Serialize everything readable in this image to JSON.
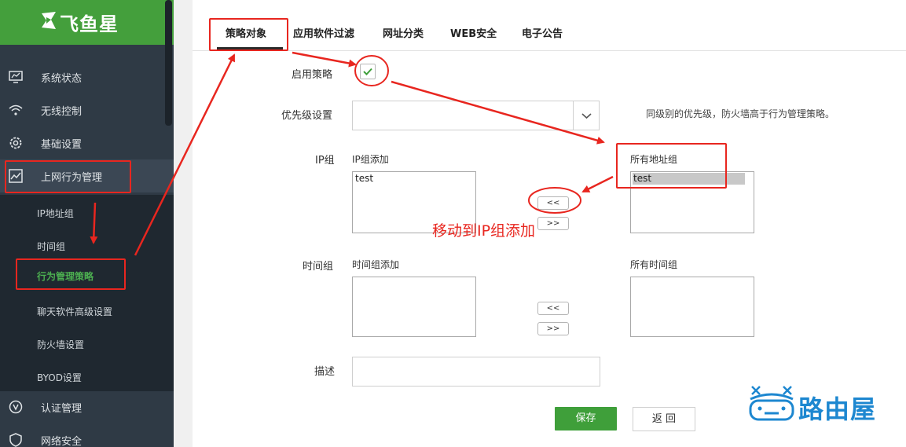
{
  "brand": {
    "name": "飞鱼星"
  },
  "sidebar": {
    "items": [
      {
        "label": "系统状态",
        "icon": "monitor-icon"
      },
      {
        "label": "无线控制",
        "icon": "wifi-icon"
      },
      {
        "label": "基础设置",
        "icon": "gear-icon"
      },
      {
        "label": "上网行为管理",
        "icon": "chart-icon"
      },
      {
        "label": "认证管理",
        "icon": "v-circle-icon"
      },
      {
        "label": "网络安全",
        "icon": "shield-icon"
      }
    ],
    "submenu": [
      {
        "label": "IP地址组"
      },
      {
        "label": "时间组"
      },
      {
        "label": "行为管理策略"
      },
      {
        "label": "聊天软件高级设置"
      },
      {
        "label": "防火墙设置"
      },
      {
        "label": "BYOD设置"
      }
    ]
  },
  "tabs": [
    "策略对象",
    "应用软件过滤",
    "网址分类",
    "WEB安全",
    "电子公告"
  ],
  "form": {
    "enable_label": "启用策略",
    "priority_label": "优先级设置",
    "priority_value": "",
    "priority_hint": "同级别的优先级，防火墙高于行为管理策略。",
    "ip_group_label": "IP组",
    "ip_add_label": "IP组添加",
    "ip_add_items": [
      "test"
    ],
    "all_address_label": "所有地址组",
    "all_address_items": [
      "test"
    ],
    "time_group_label": "时间组",
    "time_add_label": "时间组添加",
    "all_time_label": "所有时间组",
    "move_left": "<<",
    "move_right": ">>",
    "desc_label": "描述",
    "desc_value": "",
    "save": "保存",
    "back": "返 回"
  },
  "annotation": {
    "text": "移动到IP组添加"
  },
  "watermark": {
    "text": "路由屋"
  },
  "colors": {
    "brand_green": "#449f3c",
    "sidebar_bg": "#2f3a45",
    "annotation_red": "#e8261f",
    "watermark_blue": "#1d87d0"
  }
}
